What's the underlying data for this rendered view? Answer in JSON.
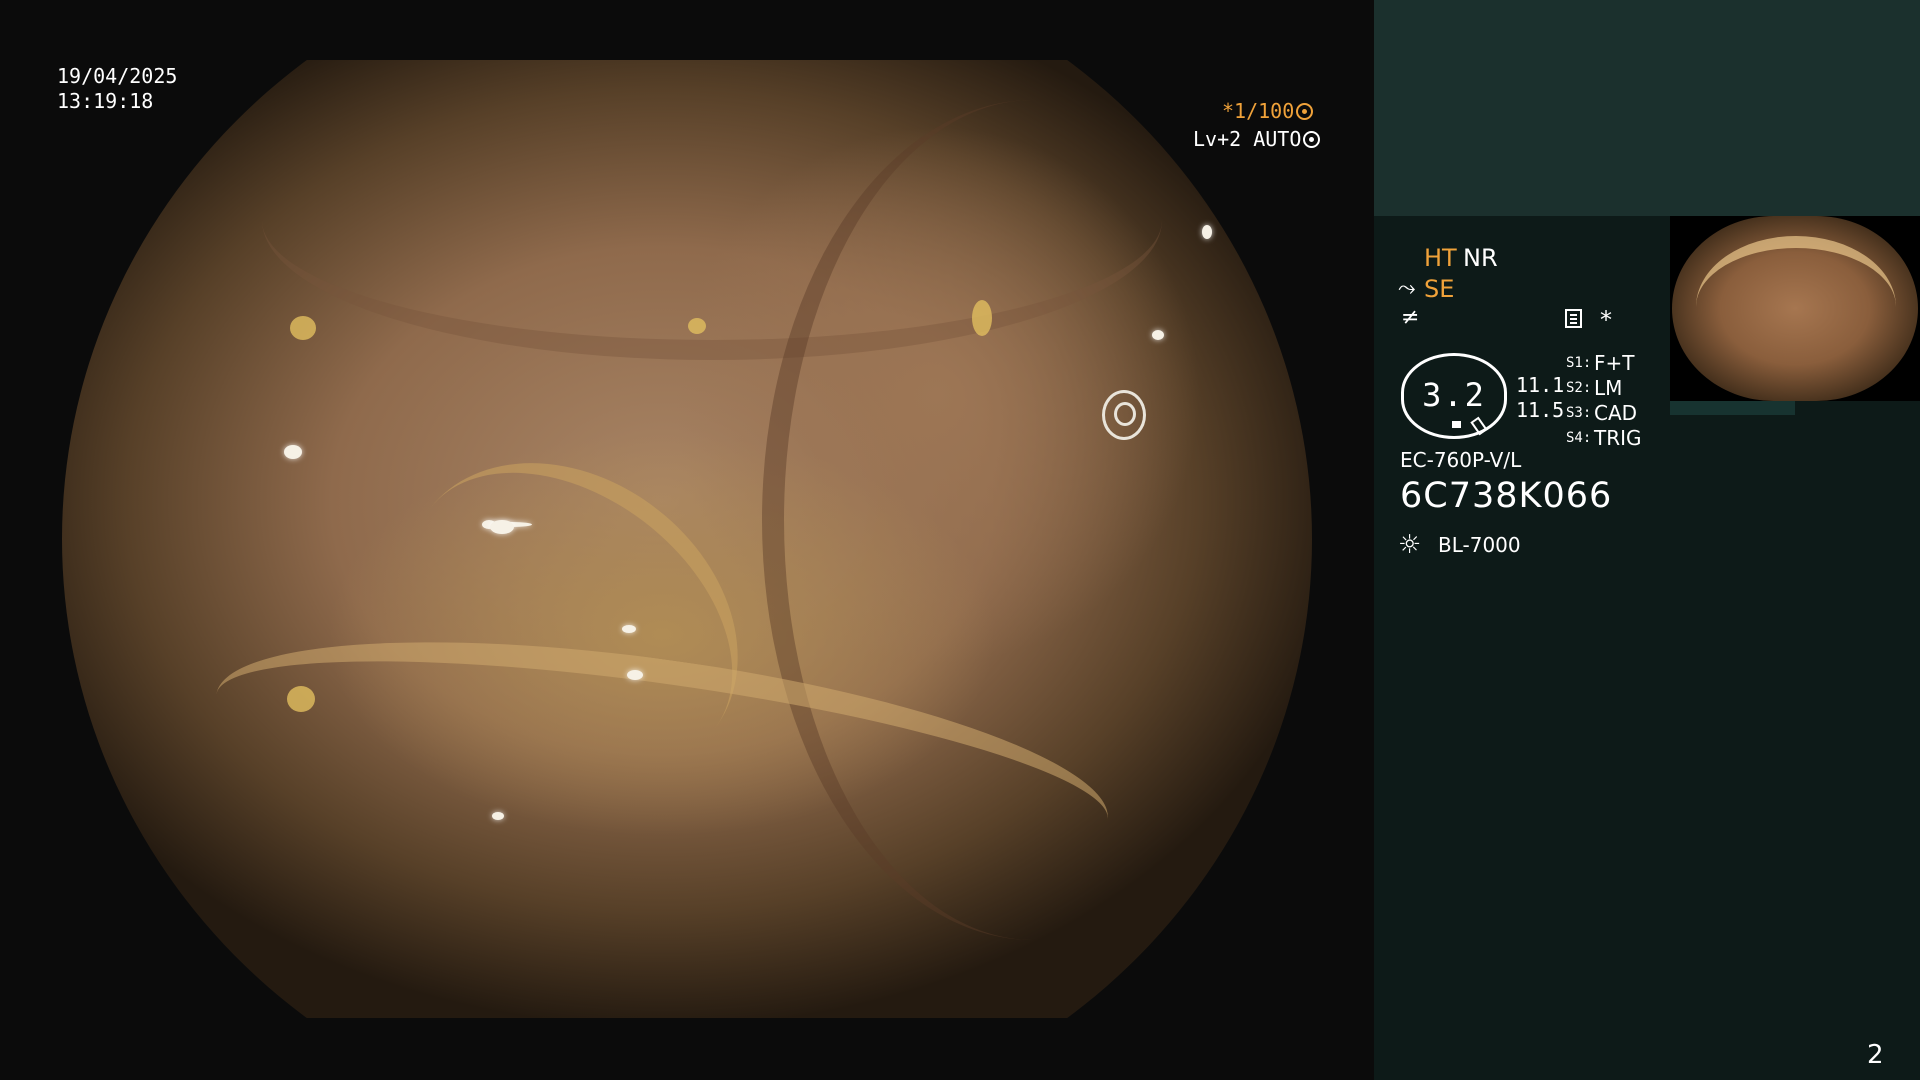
{
  "overlay": {
    "date": "19/04/2025",
    "time": "13:19:18",
    "shutter": "*1/100",
    "level": "Lv+2 AUTO"
  },
  "panel": {
    "ht": "HT",
    "nr": "NR",
    "se": "SE",
    "star": "*",
    "gauge_value": "3.2",
    "gauge_side_1": "11.1",
    "gauge_side_2": "11.5",
    "switches": [
      {
        "label": "S1:",
        "value": "F+T"
      },
      {
        "label": "S2:",
        "value": "LM"
      },
      {
        "label": "S3:",
        "value": "CAD"
      },
      {
        "label": "S4:",
        "value": "TRIG"
      }
    ],
    "scope_model": "EC-760P-V/L",
    "scope_serial": "6C738K066",
    "light_source": "BL-7000"
  },
  "page_number": "2",
  "colors": {
    "accent_orange": "#f0a23a",
    "panel_top": "#1b302d",
    "panel_main": "#0d1a18"
  },
  "icons": [
    "shutter-icon",
    "auto-iris-icon",
    "structure-enhance-icon",
    "freeze-icon",
    "menu-icon",
    "light-source-icon"
  ]
}
